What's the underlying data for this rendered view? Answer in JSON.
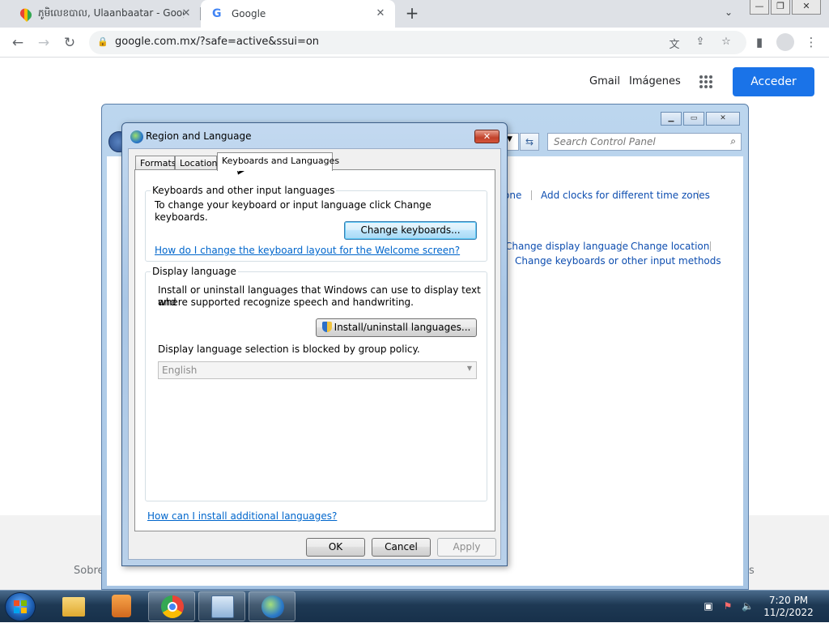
{
  "browser": {
    "tabs": [
      {
        "title": "ភូមិលេខបាល, Ulaanbaatar - Goog",
        "favicon": "maps-pin-icon"
      },
      {
        "title": "Google",
        "favicon": "google-g-icon"
      }
    ],
    "new_tab": "+",
    "tab_search": "⌄",
    "window_controls": {
      "minimize": "—",
      "maximize": "❐",
      "close": "✕"
    },
    "url": "google.com.mx/?safe=active&ssui=on",
    "accent": "#1a73e8"
  },
  "google": {
    "gmail": "Gmail",
    "images": "Imágenes",
    "signin": "Acceder",
    "footer_left": "Sobre",
    "footer_right": "s"
  },
  "control_panel": {
    "search_placeholder": "Search Control Panel",
    "links": {
      "tz_partial": "one",
      "add_clocks": "Add clocks for different time zones",
      "change_display_language": "Change display language",
      "change_location": "Change location",
      "change_keyboards": "Change keyboards or other input methods"
    }
  },
  "dialog": {
    "title": "Region and Language",
    "close": "✕",
    "tabs": [
      "Formats",
      "Location",
      "Keyboards and Languages"
    ],
    "active_tab": "Keyboards and Languages",
    "keyboards_group": {
      "label": "Keyboards and other input languages",
      "description": "To change your keyboard or input language click Change keyboards.",
      "button": "Change keyboards...",
      "help_link": "How do I change the keyboard layout for the Welcome screen?"
    },
    "display_group": {
      "label": "Display language",
      "description_line1": "Install or uninstall languages that Windows can use to display text and",
      "description_line2": "where supported recognize speech and handwriting.",
      "button": "Install/uninstall languages...",
      "policy_text": "Display language selection is blocked by group policy.",
      "selected_language": "English"
    },
    "install_link": "How can I install additional languages?",
    "buttons": {
      "ok": "OK",
      "cancel": "Cancel",
      "apply": "Apply"
    }
  },
  "taskbar": {
    "time": "7:20 PM",
    "date": "11/2/2022"
  }
}
